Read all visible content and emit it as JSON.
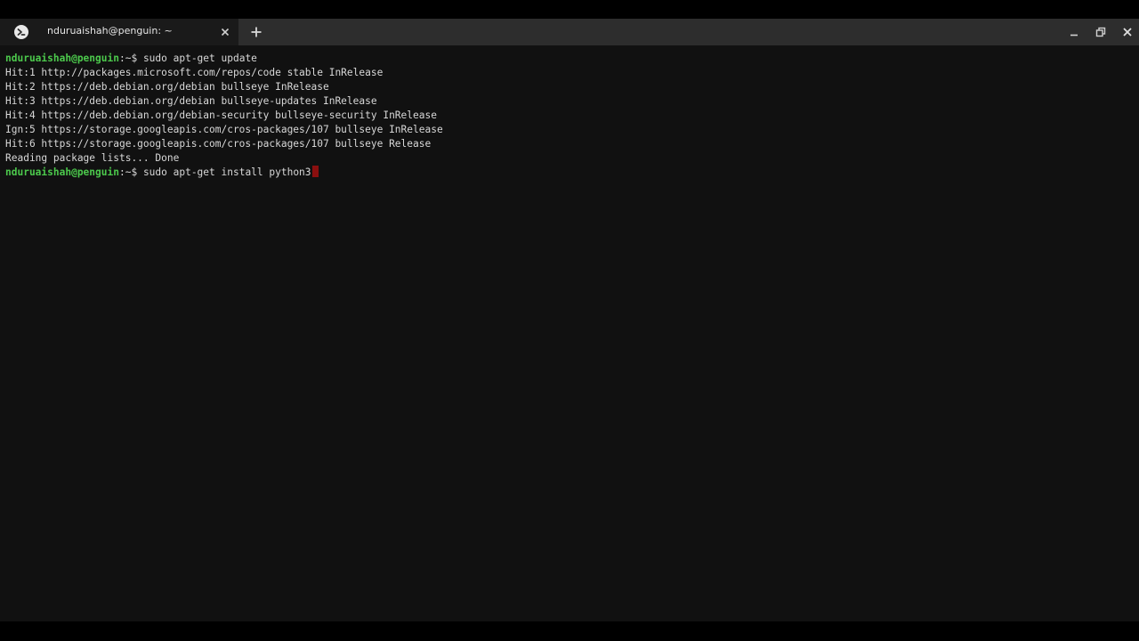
{
  "tab": {
    "title": "nduruaishah@penguin: ~",
    "close_icon": "close-icon",
    "new_tab_icon": "plus-icon"
  },
  "window_controls": [
    "minimize-icon",
    "maximize-icon",
    "close-icon"
  ],
  "terminal": {
    "prompt_user": "nduruaishah@penguin",
    "prompt_suffix": ":~$ ",
    "lines": [
      {
        "type": "prompt",
        "command": "sudo apt-get update"
      },
      {
        "type": "output",
        "text": "Hit:1 http://packages.microsoft.com/repos/code stable InRelease"
      },
      {
        "type": "output",
        "text": "Hit:2 https://deb.debian.org/debian bullseye InRelease"
      },
      {
        "type": "output",
        "text": "Hit:3 https://deb.debian.org/debian bullseye-updates InRelease"
      },
      {
        "type": "output",
        "text": "Hit:4 https://deb.debian.org/debian-security bullseye-security InRelease"
      },
      {
        "type": "output",
        "text": "Ign:5 https://storage.googleapis.com/cros-packages/107 bullseye InRelease"
      },
      {
        "type": "output",
        "text": "Hit:6 https://storage.googleapis.com/cros-packages/107 bullseye Release"
      },
      {
        "type": "output",
        "text": "Reading package lists... Done"
      },
      {
        "type": "prompt",
        "command": "sudo apt-get install python3",
        "cursor": true
      }
    ]
  },
  "colors": {
    "prompt_user": "#4cc94c",
    "cursor": "#8a0f0f",
    "background": "#111111",
    "titlebar": "#2d2d2d"
  }
}
